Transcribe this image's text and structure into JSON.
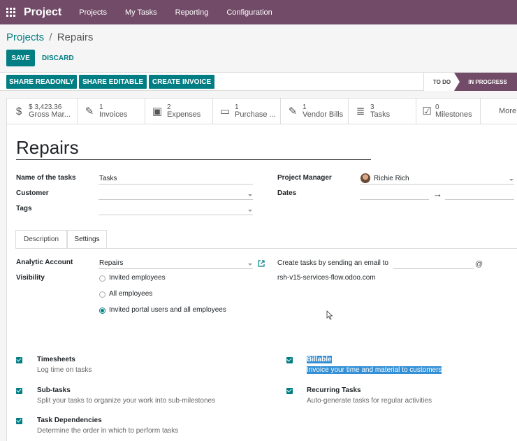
{
  "nav": {
    "brand": "Project",
    "menu": [
      "Projects",
      "My Tasks",
      "Reporting",
      "Configuration"
    ]
  },
  "breadcrumb": {
    "parent": "Projects",
    "separator": "/",
    "current": "Repairs"
  },
  "buttons": {
    "save": "SAVE",
    "discard": "DISCARD"
  },
  "actions": [
    "SHARE READONLY",
    "SHARE EDITABLE",
    "CREATE INVOICE"
  ],
  "stages": {
    "todo": "TO DO",
    "in_progress": "IN PROGRESS",
    "active": "IN PROGRESS"
  },
  "smart_buttons": [
    {
      "icon": "dollar-icon",
      "glyph": "$",
      "value": "$ 3,423.36",
      "label": "Gross Mar..."
    },
    {
      "icon": "pencil-icon",
      "glyph": "✎",
      "value": "1",
      "label": "Invoices"
    },
    {
      "icon": "money-icon",
      "glyph": "▣",
      "value": "2",
      "label": "Expenses"
    },
    {
      "icon": "credit-card-icon",
      "glyph": "▭",
      "value": "1",
      "label": "Purchase ..."
    },
    {
      "icon": "pencil-icon",
      "glyph": "✎",
      "value": "1",
      "label": "Vendor Bills"
    },
    {
      "icon": "tasks-icon",
      "glyph": "≣",
      "value": "3",
      "label": "Tasks"
    },
    {
      "icon": "check-square-icon",
      "glyph": "☑",
      "value": "0",
      "label": "Milestones"
    }
  ],
  "smart_more": "More",
  "record": {
    "name": "Repairs",
    "fields": {
      "name_of_tasks_label": "Name of the tasks",
      "name_of_tasks_value": "Tasks",
      "customer_label": "Customer",
      "customer_value": "",
      "tags_label": "Tags",
      "tags_value": "",
      "project_manager_label": "Project Manager",
      "project_manager_value": "Richie Rich",
      "dates_label": "Dates",
      "dates_arrow": "→"
    }
  },
  "tabs": {
    "description": "Description",
    "settings": "Settings",
    "active": "Settings"
  },
  "settings": {
    "analytic_account_label": "Analytic Account",
    "analytic_account_value": "Repairs",
    "visibility_label": "Visibility",
    "visibility_options": [
      "Invited employees",
      "All employees",
      "Invited portal users and all employees"
    ],
    "visibility_selected": "Invited portal users and all employees",
    "email_label": "Create tasks by sending an email to",
    "email_domain": "rsh-v15-services-flow.odoo.com",
    "at": "@"
  },
  "options": [
    {
      "title": "Timesheets",
      "desc": "Log time on tasks",
      "checked": true
    },
    {
      "title": "Billable",
      "desc": "Invoice your time and material to customers",
      "checked": true
    },
    {
      "title": "Sub-tasks",
      "desc": "Split your tasks to organize your work into sub-milestones",
      "checked": true
    },
    {
      "title": "Recurring Tasks",
      "desc": "Auto-generate tasks for regular activities",
      "checked": true
    },
    {
      "title": "Task Dependencies",
      "desc": "Determine the order in which to perform tasks",
      "checked": true
    }
  ],
  "colors": {
    "brand": "#714b67",
    "primary": "#017e84",
    "selection": "#3390d6"
  }
}
